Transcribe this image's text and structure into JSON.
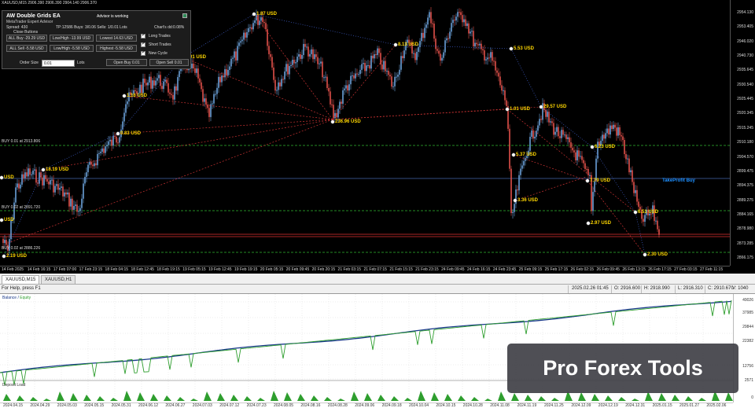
{
  "window": {
    "symbol_title": "XAUUSD,M15  2906.390 2906.390 2904.140 2906.370"
  },
  "ea_panel": {
    "title": "AW Double Grids EA",
    "subtitle": "MetaTrader Expert Advisor",
    "status": "Advisor is working",
    "spread": "Spread: 430",
    "tp_info": "TP:12586 Buys: 3/0.06 Sells: 1/0.01 Lots",
    "drawdown": "Chart's dd:0.08%",
    "close_buttons_label": "Close Buttons",
    "buttons": {
      "all_buy": "ALL Buy -29.29 USD",
      "low_high_buy": "Low/High -13.99 USD",
      "lowest": "Lowest 14.63 USD",
      "all_sell": "ALL Sell -5.58 USD",
      "low_high_sell": "Low/High -5.58 USD",
      "highest": "Highest -5.58 USD",
      "open_buy": "Open Buy 0.01",
      "open_sell": "Open Sell 0.01"
    },
    "checkboxes": [
      "Long Trades",
      "Short Trades",
      "New Cycle"
    ],
    "order_size_label": "Order Size",
    "order_size_value": "0.01",
    "lots_label": "Lots"
  },
  "price_axis": [
    "2954.130",
    "2953.405",
    "2946.020",
    "2940.730",
    "2935.645",
    "2930.540",
    "2925.445",
    "2920.345",
    "2915.245",
    "2910.180",
    "2904.570",
    "2899.475",
    "2894.375",
    "2889.275",
    "2884.165",
    "2878.980",
    "2873.285",
    "2866.175"
  ],
  "time_axis": [
    "14 Feb 2025",
    "14 Feb 16:15",
    "17 Feb 07:00",
    "17 Feb 23:15",
    "18 Feb 04:15",
    "18 Feb 12:45",
    "18 Feb 19:15",
    "19 Feb 05:15",
    "19 Feb 12:45",
    "19 Feb 19:15",
    "20 Feb 05:15",
    "20 Feb 09:45",
    "20 Feb 20:15",
    "21 Feb 03:15",
    "21 Feb 07:15",
    "21 Feb 15:15",
    "21 Feb 23:15",
    "24 Feb 09:45",
    "24 Feb 16:15",
    "24 Feb 23:45",
    "25 Feb 09:15",
    "25 Feb 17:15",
    "26 Feb 02:15",
    "26 Feb 09:45",
    "26 Feb 13:15",
    "26 Feb 17:15",
    "27 Feb 03:15",
    "27 Feb 11:15"
  ],
  "trade_labels": [
    "1.87 USD",
    "8.13 USD",
    "5.53 USD",
    "1.01 USD",
    "1.16 USD",
    "236.96 USD",
    "1.01 USD",
    "29.57 USD",
    "0.83 USD",
    "6.23 USD",
    "5.37 USD",
    "18.19 USD",
    "7.79 USD",
    "3.36 USD",
    "6.51 USD",
    "2.97 USD",
    "2.19 USD",
    "2.30 USD",
    "USD",
    "USD"
  ],
  "line_labels": {
    "buy_upper": "BUY 0.01 at 2913.806",
    "buy_mid": "BUY 0.02 at 2891.720",
    "buy_low": "BUY 0.02 at 2886.226",
    "take_profit": "TakeProfit Buy"
  },
  "tabs": [
    "XAUUSD,M15",
    "XAUUSD,H1"
  ],
  "status": {
    "help": "For Help, press F1",
    "datetime": "2025.02.26 01:45",
    "open": "O: 2916.600",
    "high": "H: 2918.990",
    "low": "L: 2916.310",
    "close": "C: 2910.670",
    "volume": "V: 1040"
  },
  "balance": {
    "legend_balance": "Balance",
    "legend_equity": "Equity",
    "deposit_label": "Deposit Load",
    "axis": [
      "49026",
      "37985",
      "29844",
      "22382",
      "12756",
      "2571",
      "0"
    ],
    "dates": [
      "2024.04.15",
      "2024.04.29",
      "2024.05.03",
      "2024.05.15",
      "2024.05.31",
      "2024.06.12",
      "2024.06.27",
      "2024.07.03",
      "2024.07.12",
      "2024.07.23",
      "2024.08.05",
      "2024.08.16",
      "2024.08.28",
      "2024.09.06",
      "2024.09.18",
      "2024.10.04",
      "2024.10.15",
      "2024.10.28",
      "2024.11.08",
      "2024.11.19",
      "2024.11.25",
      "2024.12.09",
      "2024.12.19",
      "2024.12.31",
      "2025.01.15",
      "2025.01.27",
      "2025.02.06"
    ]
  },
  "brand": "Pro Forex Tools",
  "colors": {
    "up_candle": "#6a9fd8",
    "down_candle": "#e0504a",
    "grid_green": "#2fb82f",
    "price_line": "#e03030",
    "trade_dots_red": "#c83232",
    "trade_dots_blue": "#4060d0",
    "balance_line": "#1a3a8a",
    "equity_line": "#2e9e2e"
  }
}
